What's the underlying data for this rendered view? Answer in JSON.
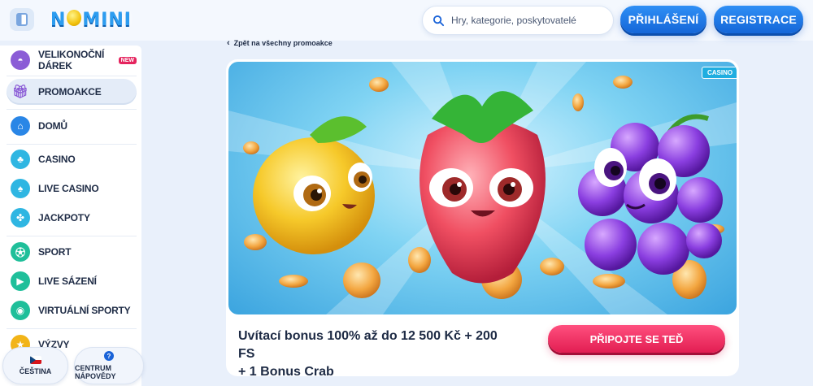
{
  "header": {
    "logo_text": "NOMINI",
    "search_placeholder": "Hry, kategorie, poskytovatelé",
    "login_label": "PŘIHLÁŠENÍ",
    "register_label": "REGISTRACE"
  },
  "sidebar": {
    "items": [
      {
        "label": "VELIKONOČNÍ DÁREK",
        "icon": "gift-egg-icon",
        "badge": "NEW"
      },
      {
        "label": "PROMOAKCE",
        "icon": "gift-icon"
      },
      {
        "label": "DOMŮ",
        "icon": "home-icon"
      },
      {
        "label": "CASINO",
        "icon": "cherries-icon"
      },
      {
        "label": "LIVE CASINO",
        "icon": "cards-icon"
      },
      {
        "label": "JACKPOTY",
        "icon": "clover-icon"
      },
      {
        "label": "SPORT",
        "icon": "football-icon"
      },
      {
        "label": "LIVE SÁZENÍ",
        "icon": "live-tv-icon"
      },
      {
        "label": "VIRTUÁLNÍ SPORTY",
        "icon": "virtual-ball-icon"
      },
      {
        "label": "VÝZVY",
        "icon": "challenge-icon"
      }
    ],
    "language_label": "ČEŠTINA",
    "help_label": "CENTRUM NÁPOVĚDY"
  },
  "main": {
    "back_label": "Zpět na všechny promoakce",
    "tag": "CASINO",
    "promo_title_line1": "Uvítací bonus 100% až do 12 500 Kč + 200 FS",
    "promo_title_line2": "+ 1 Bonus Crab",
    "cta_label": "PŘIPOJTE SE TEĎ"
  },
  "colors": {
    "accent_blue": "#1f7ae8",
    "cta_pink": "#f0305f",
    "background": "#e9f0fb"
  }
}
